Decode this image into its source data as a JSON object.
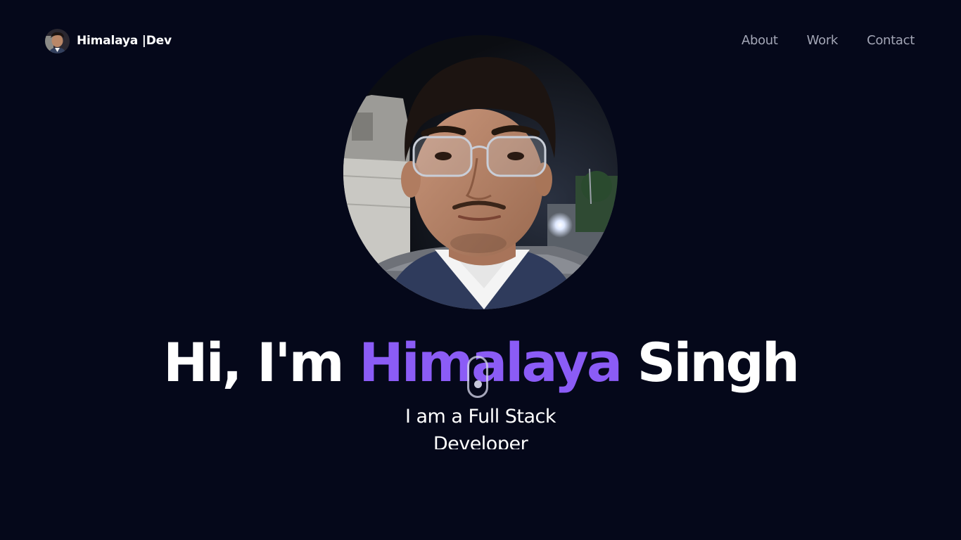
{
  "header": {
    "brand_name": "Himalaya",
    "brand_suffix": " |Dev"
  },
  "nav": {
    "items": [
      "About",
      "Work",
      "Contact"
    ]
  },
  "hero": {
    "greeting": "Hi, I'm",
    "first_name": "Himalaya",
    "last_name": "Singh",
    "subtitle": "I am a Full Stack Developer",
    "accent_color": "#8b5cf6"
  },
  "icons": {
    "scroll_indicator": "mouse-scroll-icon"
  }
}
